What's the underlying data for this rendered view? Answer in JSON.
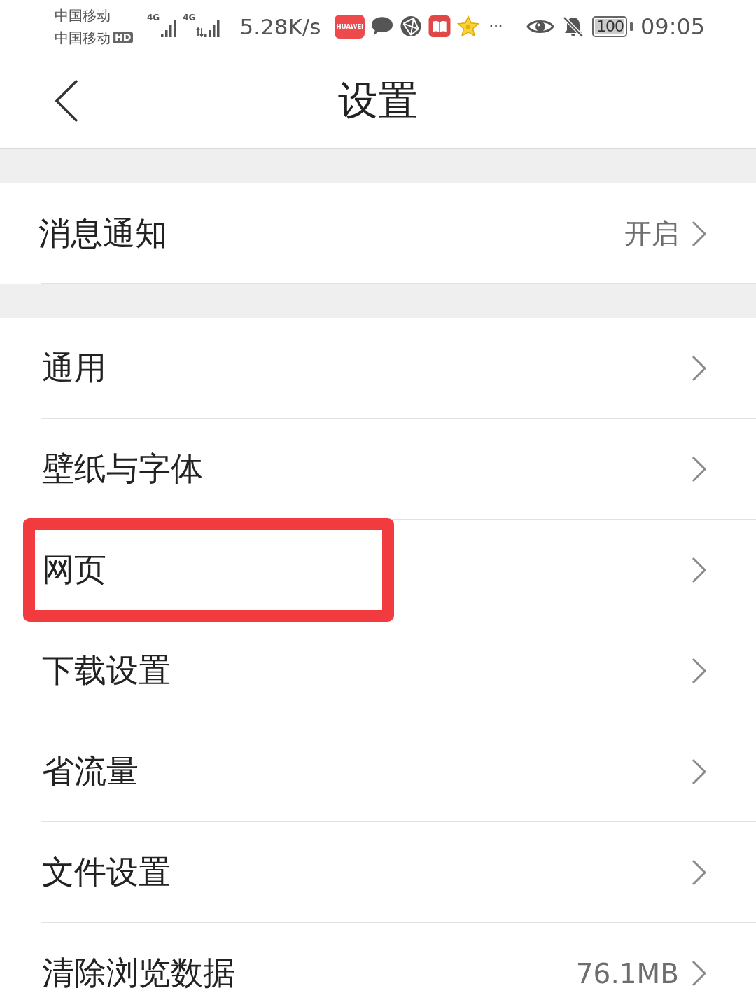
{
  "status_bar": {
    "carriers": [
      {
        "name": "中国移动"
      },
      {
        "name": "中国移动",
        "badge": "HD"
      }
    ],
    "signals": [
      {
        "label": "4G",
        "kind": "plain"
      },
      {
        "label": "4G",
        "kind": "data"
      }
    ],
    "net_speed": "5.28K/s",
    "app_icon_label": "HUAWEI",
    "more": "···",
    "battery": "100",
    "time": "09:05"
  },
  "header": {
    "title": "设置"
  },
  "sections": [
    {
      "items": [
        {
          "label": "消息通知",
          "value": "开启",
          "highlighted": false
        }
      ]
    },
    {
      "items": [
        {
          "label": "通用",
          "highlighted": false
        },
        {
          "label": "壁纸与字体",
          "highlighted": false
        },
        {
          "label": "网页",
          "highlighted": true
        },
        {
          "label": "下载设置",
          "highlighted": false
        },
        {
          "label": "省流量",
          "highlighted": false
        },
        {
          "label": "文件设置",
          "highlighted": false
        },
        {
          "label": "清除浏览数据",
          "value": "76.1MB",
          "highlighted": false
        }
      ]
    }
  ]
}
